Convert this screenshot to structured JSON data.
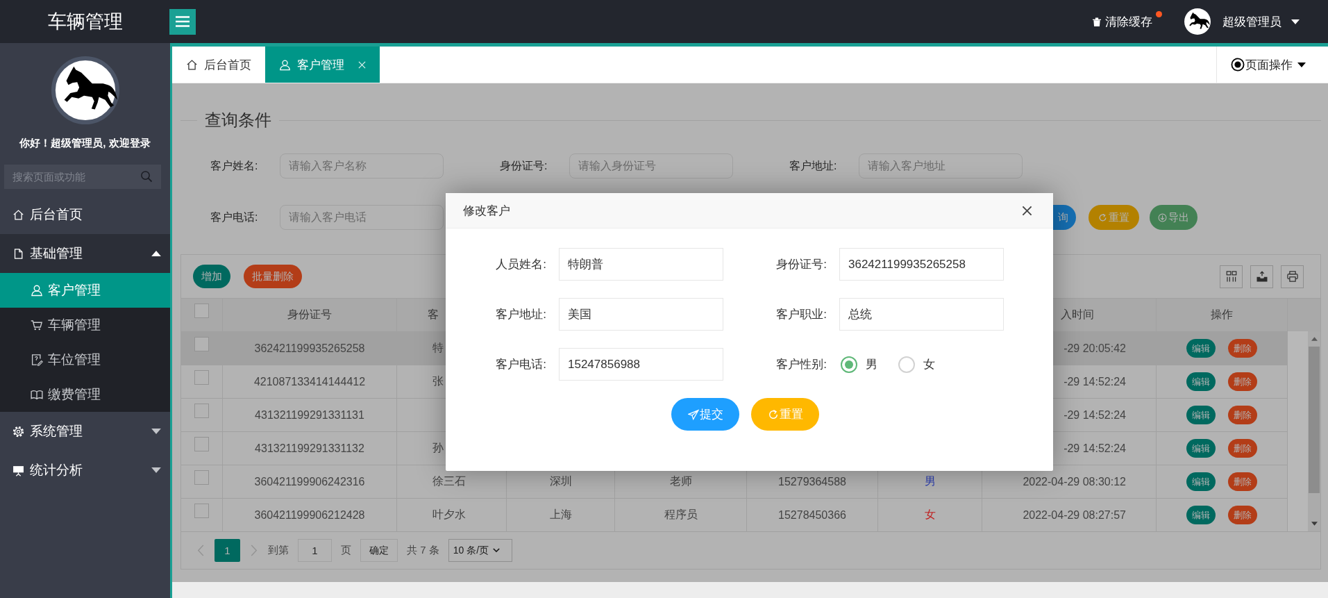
{
  "app": {
    "title": "车辆管理"
  },
  "header": {
    "clear_cache": {
      "label": "清除缓存",
      "unread": true
    },
    "user": {
      "name": "超级管理员"
    }
  },
  "sidebar": {
    "greeting": "你好！超级管理员, 欢迎登录",
    "search": {
      "placeholder": "搜索页面或功能"
    },
    "menu": [
      {
        "label": "后台首页",
        "kind": "link",
        "selected": false
      },
      {
        "label": "基础管理",
        "kind": "group",
        "selected": false,
        "expanded": true,
        "children": [
          {
            "label": "客户管理",
            "selected": true
          },
          {
            "label": "车辆管理",
            "selected": false
          },
          {
            "label": "车位管理",
            "selected": false
          },
          {
            "label": "缴费管理",
            "selected": false
          }
        ]
      },
      {
        "label": "系统管理",
        "kind": "group",
        "selected": false,
        "expanded": false
      },
      {
        "label": "统计分析",
        "kind": "group",
        "selected": false,
        "expanded": false
      }
    ]
  },
  "tabs": [
    {
      "label": "后台首页",
      "selected": false,
      "closable": false
    },
    {
      "label": "客户管理",
      "selected": true,
      "closable": true
    }
  ],
  "page_actions": {
    "label": "页面操作"
  },
  "query": {
    "title": "查询条件",
    "fields": [
      {
        "label": "客户姓名:",
        "placeholder": "请输入客户名称"
      },
      {
        "label": "身份证号:",
        "placeholder": "请输入身份证号"
      },
      {
        "label": "客户地址:",
        "placeholder": "请输入客户地址"
      },
      {
        "label": "客户电话:",
        "placeholder": "请输入客户电话"
      }
    ],
    "buttons": [
      {
        "label": "询",
        "kind": "search"
      },
      {
        "label": "重置",
        "kind": "reset"
      },
      {
        "label": "导出",
        "kind": "export"
      }
    ]
  },
  "table": {
    "toolbar": [
      {
        "label": "增加",
        "kind": "add"
      },
      {
        "label": "批量删除",
        "kind": "delete"
      }
    ],
    "select_all": {
      "checked": false
    },
    "columns": {
      "id_number": "身份证号",
      "name": "客",
      "entry_time": "入时间",
      "actions": "操作"
    },
    "rows": [
      {
        "checked": false,
        "highlighted": true,
        "id_number": "362421199935265258",
        "name": "特",
        "entry_time": "-29 20:05:42",
        "actions": [
          {
            "label": "编辑",
            "kind": "edit"
          },
          {
            "label": "删除",
            "kind": "delete"
          }
        ]
      },
      {
        "checked": false,
        "highlighted": false,
        "id_number": "421087133414144412",
        "name": "张",
        "entry_time": "-29 14:52:24",
        "actions": [
          {
            "label": "编辑",
            "kind": "edit"
          },
          {
            "label": "删除",
            "kind": "delete"
          }
        ]
      },
      {
        "checked": false,
        "highlighted": false,
        "id_number": "431321199291331131",
        "entry_time": "-29 14:52:24",
        "actions": [
          {
            "label": "编辑",
            "kind": "edit"
          },
          {
            "label": "删除",
            "kind": "delete"
          }
        ]
      },
      {
        "checked": false,
        "highlighted": false,
        "id_number": "431321199291331132",
        "name": "孙",
        "entry_time": "-29 14:52:24",
        "actions": [
          {
            "label": "编辑",
            "kind": "edit"
          },
          {
            "label": "删除",
            "kind": "delete"
          }
        ]
      },
      {
        "checked": false,
        "highlighted": false,
        "id_number": "360421199906242316",
        "name": "徐三石",
        "address": "深圳",
        "occupation": "老师",
        "phone": "15279364588",
        "gender": {
          "text": "男",
          "color": "#2a3cae"
        },
        "entry_time": "2022-04-29 08:30:12",
        "actions": [
          {
            "label": "编辑",
            "kind": "edit"
          },
          {
            "label": "删除",
            "kind": "delete"
          }
        ]
      },
      {
        "checked": false,
        "highlighted": false,
        "id_number": "360421199906212428",
        "name": "叶夕水",
        "address": "上海",
        "occupation": "程序员",
        "phone": "15278450366",
        "gender": {
          "text": "女",
          "color": "#c01c1c"
        },
        "entry_time": "2022-04-29 08:27:57",
        "actions": [
          {
            "label": "编辑",
            "kind": "edit"
          },
          {
            "label": "删除",
            "kind": "delete"
          }
        ]
      }
    ]
  },
  "pagination": {
    "pages": [
      {
        "label": "1",
        "selected": true
      }
    ],
    "goto_label": "到第",
    "goto_value": "1",
    "goto_suffix": "页",
    "confirm": "确定",
    "total": "共 7 条",
    "page_size": "10 条/页"
  },
  "dialog": {
    "title": "修改客户",
    "fields": [
      {
        "label": "人员姓名:",
        "kind": "text",
        "value": "特朗普"
      },
      {
        "label": "身份证号:",
        "kind": "text",
        "value": "362421199935265258"
      },
      {
        "label": "客户地址:",
        "kind": "text",
        "value": "美国"
      },
      {
        "label": "客户职业:",
        "kind": "text",
        "value": "总统"
      },
      {
        "label": "客户电话:",
        "kind": "text",
        "value": "15247856988"
      },
      {
        "label": "客户性别:",
        "kind": "radio",
        "options": [
          {
            "label": "男",
            "selected": true
          },
          {
            "label": "女",
            "selected": false
          }
        ]
      }
    ],
    "buttons": [
      {
        "label": "提交",
        "kind": "submit"
      },
      {
        "label": "重置",
        "kind": "reset"
      }
    ]
  }
}
